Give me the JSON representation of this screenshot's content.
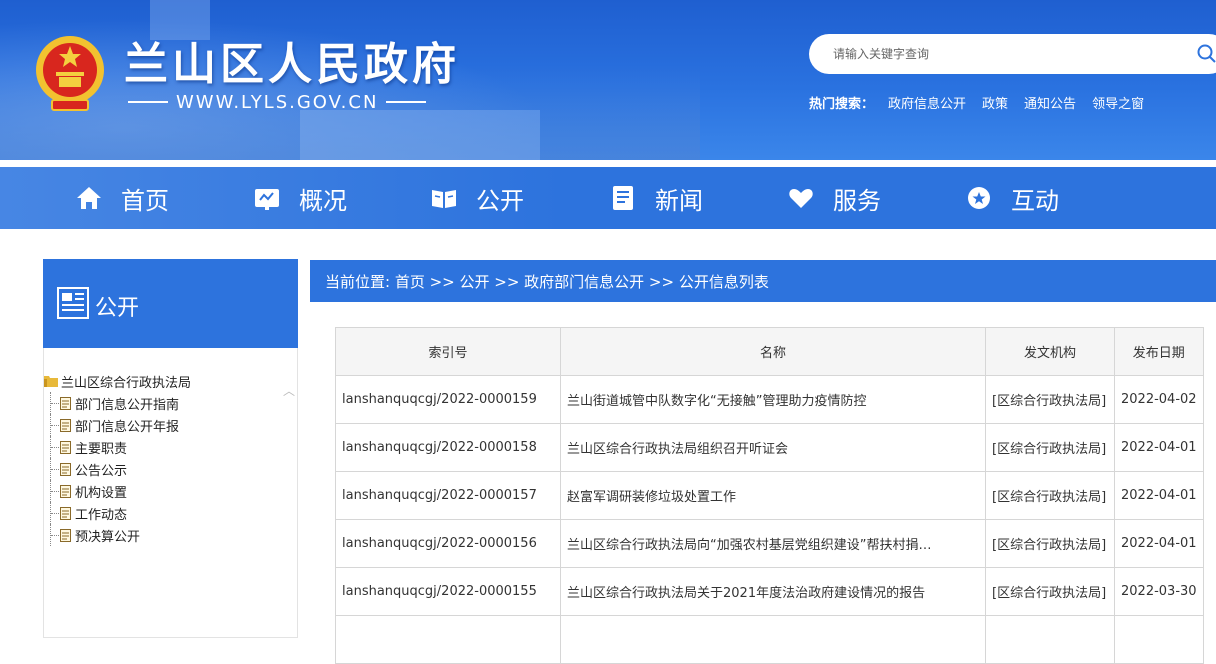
{
  "header": {
    "title": "兰山区人民政府",
    "url": "WWW.LYLS.GOV.CN",
    "search_placeholder": "请输入关键字查询",
    "hot_label": "热门搜索：",
    "hot_links": [
      "政府信息公开",
      "政策",
      "通知公告",
      "领导之窗"
    ]
  },
  "nav": [
    {
      "label": "首页",
      "icon": "home-icon"
    },
    {
      "label": "概况",
      "icon": "overview-icon"
    },
    {
      "label": "公开",
      "icon": "book-icon"
    },
    {
      "label": "新闻",
      "icon": "news-icon"
    },
    {
      "label": "服务",
      "icon": "heart-hand-icon"
    },
    {
      "label": "互动",
      "icon": "chat-icon"
    }
  ],
  "sidebar": {
    "title": "公开",
    "root": "兰山区综合行政执法局",
    "items": [
      "部门信息公开指南",
      "部门信息公开年报",
      "主要职责",
      "公告公示",
      "机构设置",
      "工作动态",
      "预决算公开"
    ]
  },
  "breadcrumb": "当前位置: 首页 >> 公开 >> 政府部门信息公开 >> 公开信息列表",
  "table": {
    "headers": [
      "索引号",
      "名称",
      "发文机构",
      "发布日期"
    ],
    "rows": [
      [
        "lanshanquqcgj/2022-0000159",
        "兰山街道城管中队数字化“无接触”管理助力疫情防控",
        "[区综合行政执法局]",
        "2022-04-02"
      ],
      [
        "lanshanquqcgj/2022-0000158",
        "兰山区综合行政执法局组织召开听证会",
        "[区综合行政执法局]",
        "2022-04-01"
      ],
      [
        "lanshanquqcgj/2022-0000157",
        "赵富军调研装修垃圾处置工作",
        "[区综合行政执法局]",
        "2022-04-01"
      ],
      [
        "lanshanquqcgj/2022-0000156",
        "兰山区综合行政执法局向“加强农村基层党组织建设”帮扶村捐…",
        "[区综合行政执法局]",
        "2022-04-01"
      ],
      [
        "lanshanquqcgj/2022-0000155",
        "兰山区综合行政执法局关于2021年度法治政府建设情况的报告",
        "[区综合行政执法局]",
        "2022-03-30"
      ]
    ]
  }
}
